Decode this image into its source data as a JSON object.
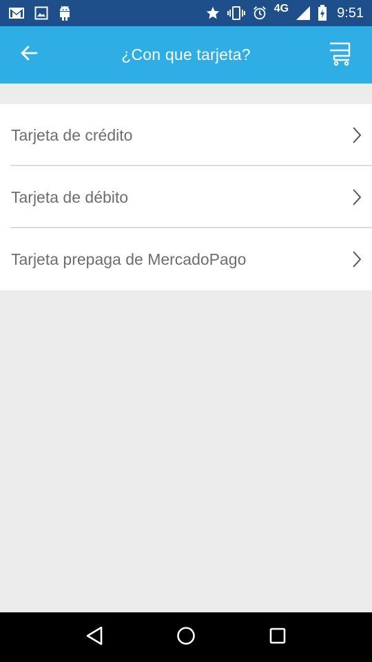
{
  "status_bar": {
    "network": "4G",
    "time": "9:51",
    "icons": [
      "gmail-icon",
      "image-icon",
      "android-icon",
      "star-icon",
      "vibrate-icon",
      "alarm-icon",
      "signal-icon",
      "battery-charging-icon"
    ]
  },
  "app_bar": {
    "title": "¿Con que tarjeta?",
    "back_icon": "arrow-left-icon",
    "cart_icon": "cart-icon"
  },
  "card_options": [
    {
      "label": "Tarjeta de crédito"
    },
    {
      "label": "Tarjeta de débito"
    },
    {
      "label": "Tarjeta prepaga de MercadoPago"
    }
  ],
  "nav_bar": {
    "icons": [
      "back-triangle-icon",
      "home-circle-icon",
      "recents-square-icon"
    ]
  },
  "colors": {
    "status_bar": "#1e4f8a",
    "app_bar": "#2eaee4",
    "background": "#ececec",
    "list_text": "#6d6d6d",
    "divider": "#dcdcdc"
  }
}
